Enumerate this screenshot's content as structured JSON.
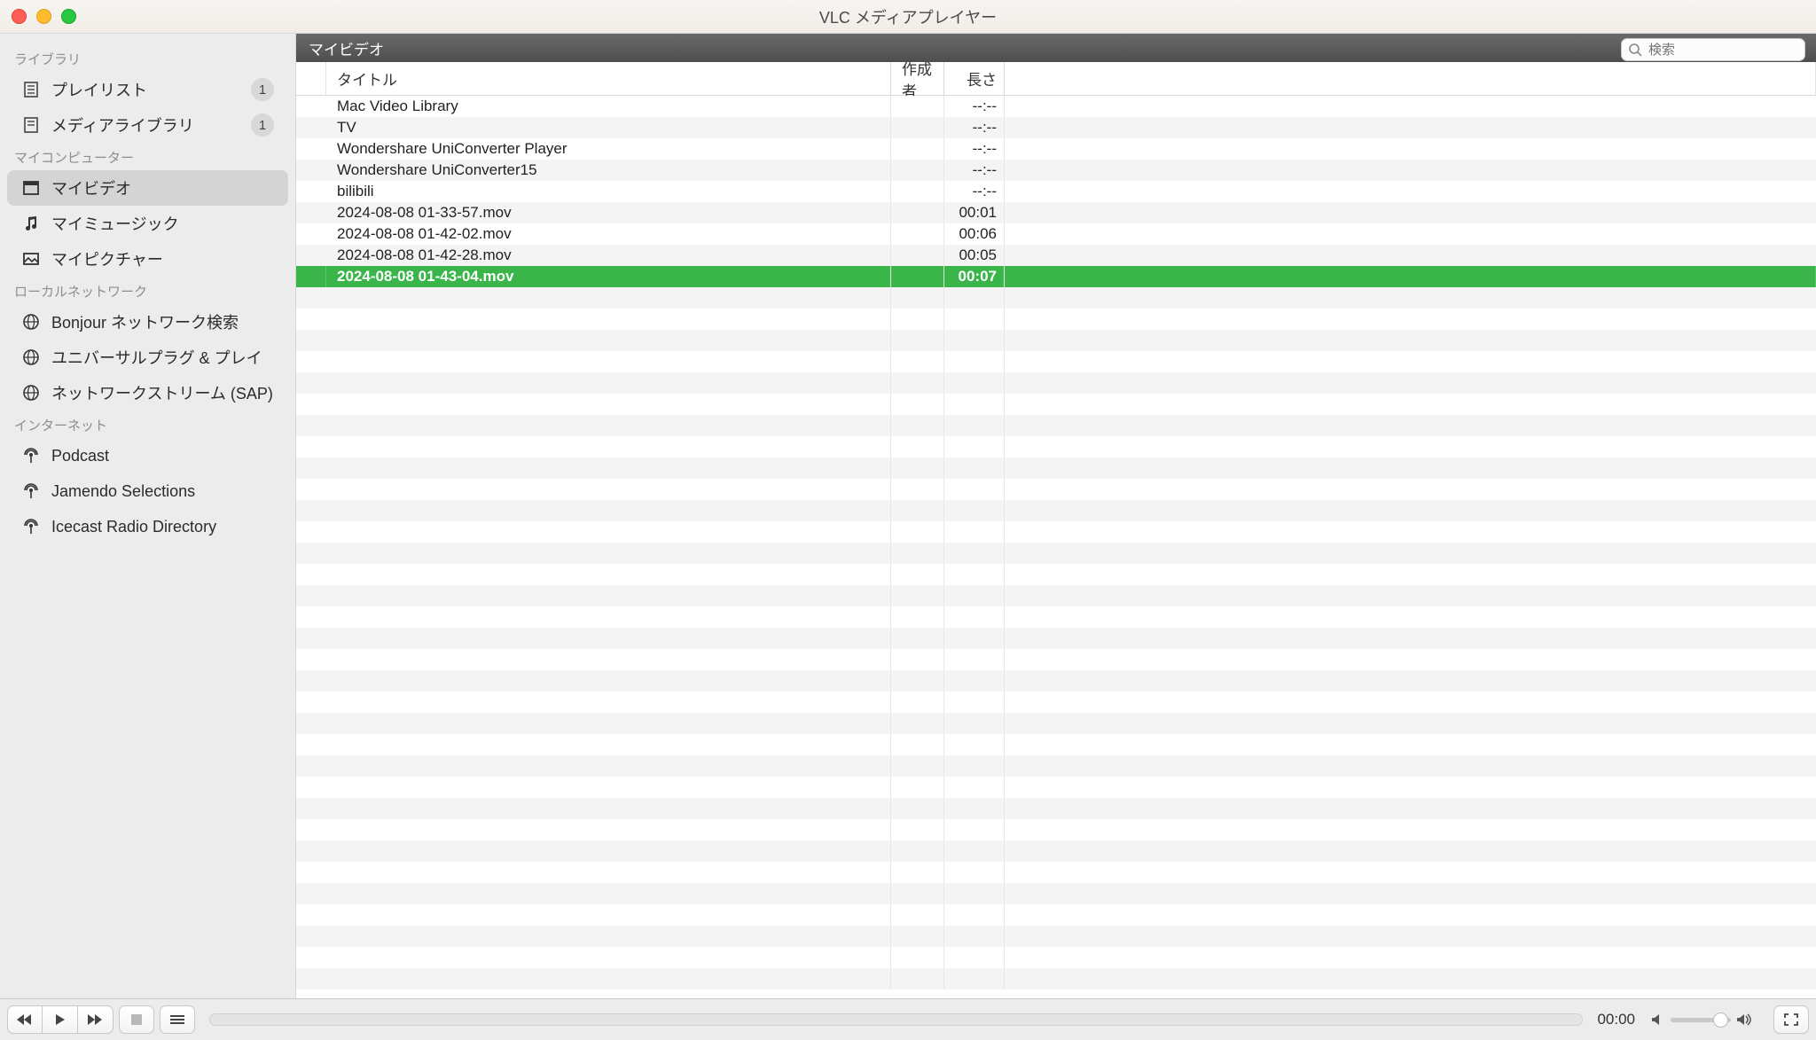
{
  "window": {
    "title": "VLC メディアプレイヤー"
  },
  "sidebar": {
    "groups": [
      {
        "label": "ライブラリ",
        "items": [
          {
            "label": "プレイリスト",
            "badge": "1",
            "icon": "playlist"
          },
          {
            "label": "メディアライブラリ",
            "badge": "1",
            "icon": "library"
          }
        ]
      },
      {
        "label": "マイコンピューター",
        "items": [
          {
            "label": "マイビデオ",
            "icon": "video",
            "selected": true
          },
          {
            "label": "マイミュージック",
            "icon": "music"
          },
          {
            "label": "マイピクチャー",
            "icon": "picture"
          }
        ]
      },
      {
        "label": "ローカルネットワーク",
        "items": [
          {
            "label": "Bonjour ネットワーク検索",
            "icon": "globe"
          },
          {
            "label": "ユニバーサルプラグ & プレイ",
            "icon": "globe"
          },
          {
            "label": "ネットワークストリーム (SAP)",
            "icon": "globe"
          }
        ]
      },
      {
        "label": "インターネット",
        "items": [
          {
            "label": "Podcast",
            "icon": "podcast"
          },
          {
            "label": "Jamendo Selections",
            "icon": "podcast"
          },
          {
            "label": "Icecast Radio Directory",
            "icon": "podcast"
          }
        ]
      }
    ]
  },
  "breadcrumb": "マイビデオ",
  "search": {
    "placeholder": "検索"
  },
  "columns": {
    "title": "タイトル",
    "author": "作成者",
    "duration": "長さ"
  },
  "rows": [
    {
      "title": "Mac Video Library",
      "author": "",
      "duration": "--:--"
    },
    {
      "title": "TV",
      "author": "",
      "duration": "--:--"
    },
    {
      "title": "Wondershare UniConverter Player",
      "author": "",
      "duration": "--:--"
    },
    {
      "title": "Wondershare UniConverter15",
      "author": "",
      "duration": "--:--"
    },
    {
      "title": "bilibili",
      "author": "",
      "duration": "--:--"
    },
    {
      "title": "2024-08-08 01-33-57.mov",
      "author": "",
      "duration": "00:01"
    },
    {
      "title": "2024-08-08 01-42-02.mov",
      "author": "",
      "duration": "00:06"
    },
    {
      "title": "2024-08-08 01-42-28.mov",
      "author": "",
      "duration": "00:05"
    },
    {
      "title": "2024-08-08 01-43-04.mov",
      "author": "",
      "duration": "00:07",
      "selected": true
    }
  ],
  "player": {
    "time": "00:00"
  },
  "empty_rows": 33
}
